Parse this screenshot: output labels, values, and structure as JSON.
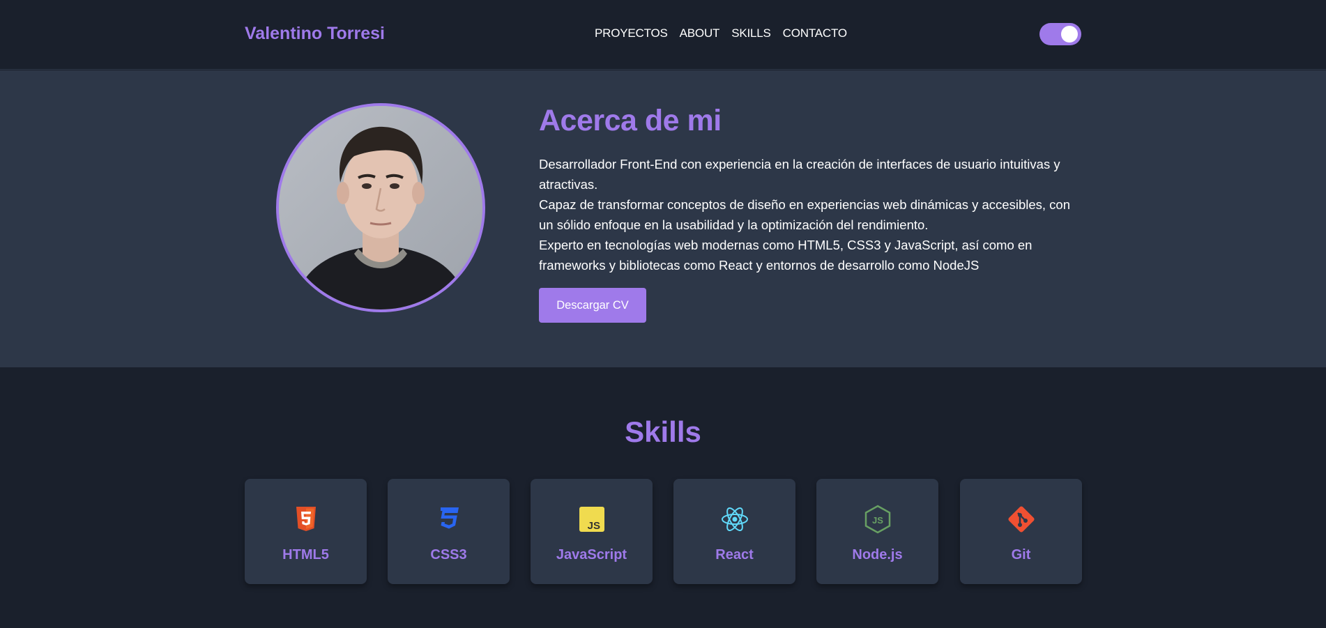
{
  "header": {
    "brand": "Valentino Torresi",
    "nav": [
      "PROYECTOS",
      "ABOUT",
      "SKILLS",
      "CONTACTO"
    ],
    "theme_toggle": {
      "on": true
    }
  },
  "about": {
    "title": "Acerca de mi",
    "paragraphs": [
      "Desarrollador Front-End con experiencia en la creación de interfaces de usuario intuitivas y atractivas.",
      "Capaz de transformar conceptos de diseño en experiencias web dinámicas y accesibles, con un sólido enfoque en la usabilidad y la optimización del rendimiento.",
      "Experto en tecnologías web modernas como HTML5, CSS3 y JavaScript, así como en frameworks y bibliotecas como React y entornos de desarrollo como NodeJS"
    ],
    "cv_button": "Descargar CV"
  },
  "skills": {
    "title": "Skills",
    "items": [
      {
        "name": "HTML5",
        "icon": "html5-icon",
        "color": "#e34f26"
      },
      {
        "name": "CSS3",
        "icon": "css3-icon",
        "color": "#2965f1"
      },
      {
        "name": "JavaScript",
        "icon": "javascript-icon",
        "color": "#f0db4f"
      },
      {
        "name": "React",
        "icon": "react-icon",
        "color": "#61dafb"
      },
      {
        "name": "Node.js",
        "icon": "nodejs-icon",
        "color": "#68a063"
      },
      {
        "name": "Git",
        "icon": "git-icon",
        "color": "#f05032"
      }
    ]
  },
  "colors": {
    "accent": "#9f7aea",
    "background": "#1a202c",
    "panel": "#2d3748"
  }
}
